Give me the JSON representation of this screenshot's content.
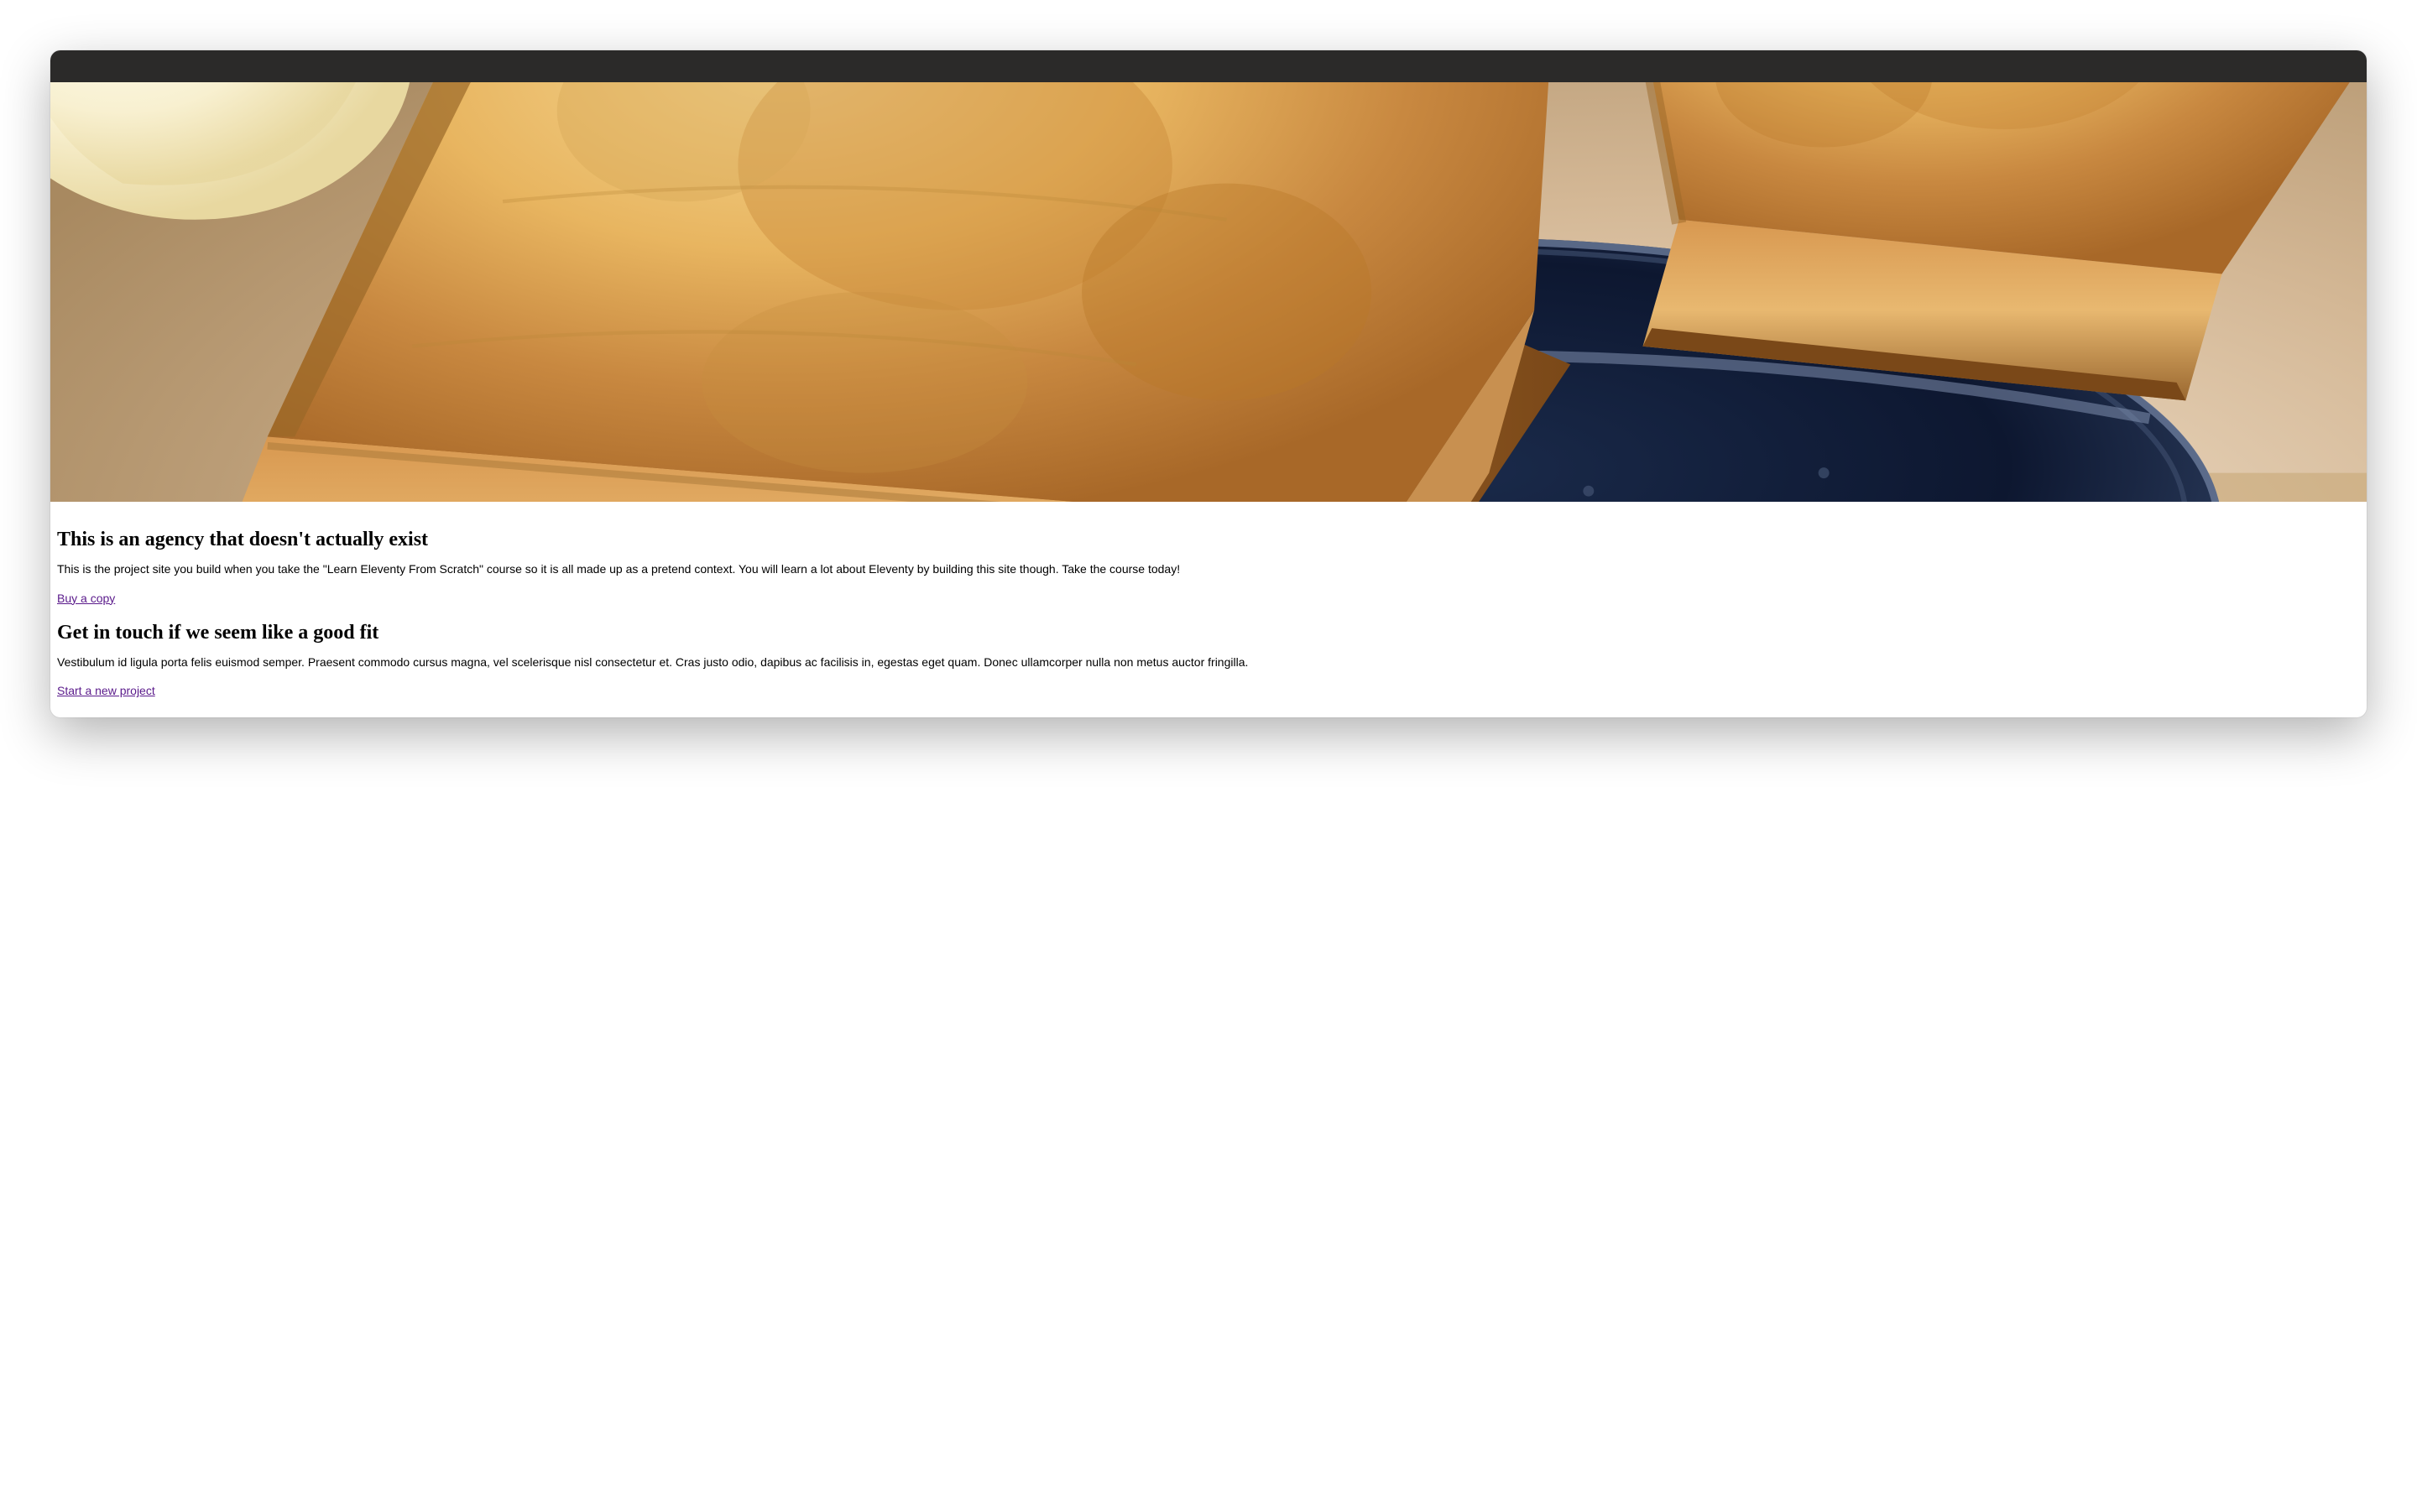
{
  "hero": {
    "image_description": "toast-on-plate"
  },
  "sections": [
    {
      "heading": "This is an agency that doesn't actually exist",
      "paragraph": "This is the project site you build when you take the \"Learn Eleventy From Scratch\" course so it is all made up as a pretend context. You will learn a lot about Eleventy by building this site though. Take the course today!",
      "link_text": "Buy a copy"
    },
    {
      "heading": "Get in touch if we seem like a good fit",
      "paragraph": "Vestibulum id ligula porta felis euismod semper. Praesent commodo cursus magna, vel scelerisque nisl consectetur et. Cras justo odio, dapibus ac facilisis in, egestas eget quam. Donec ullamcorper nulla non metus auctor fringilla.",
      "link_text": "Start a new project"
    }
  ]
}
